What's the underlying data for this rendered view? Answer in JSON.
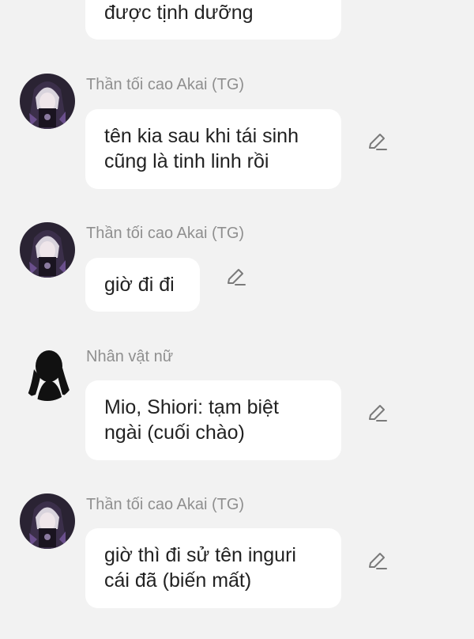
{
  "messages": [
    {
      "sender": "",
      "lines": [
        "được tịnh dưỡng"
      ],
      "editable": false
    },
    {
      "sender": "Thần tối cao Akai (TG)",
      "lines": [
        "tên kia sau khi tái sinh",
        "cũng là tinh linh rồi"
      ],
      "editable": true,
      "avatar": "dark-haired-character-avatar"
    },
    {
      "sender": "Thần tối cao Akai (TG)",
      "lines": [
        "giờ đi đi"
      ],
      "editable": true,
      "avatar": "dark-haired-character-avatar"
    },
    {
      "sender": "Nhân vật nữ",
      "lines": [
        "Mio, Shiori: tạm biệt",
        "ngài (cuối chào)"
      ],
      "editable": true,
      "avatar": "female-silhouette-avatar"
    },
    {
      "sender": "Thần tối cao Akai (TG)",
      "lines": [
        "giờ thì đi sử tên inguri",
        "cái đã (biến mất)"
      ],
      "editable": true,
      "avatar": "dark-haired-character-avatar"
    }
  ],
  "icons": {
    "edit": "pencil-edit-icon"
  },
  "colors": {
    "background": "#f2f2f2",
    "bubble": "#ffffff",
    "sender_name": "#8f8f8f",
    "message_text": "#222222",
    "edit_icon": "#7a7a7a"
  }
}
